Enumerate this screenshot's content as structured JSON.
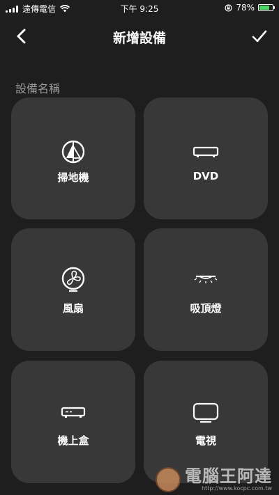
{
  "status_bar": {
    "carrier": "遠傳電信",
    "time": "下午 9:25",
    "battery": "78%",
    "battery_level": 0.78,
    "signal_icon": "signal-bars-icon",
    "wifi_icon": "wifi-icon",
    "rotation_lock_icon": "rotation-lock-icon",
    "battery_icon": "battery-charging-icon"
  },
  "nav": {
    "title": "新增設備",
    "back_icon": "chevron-left-icon",
    "confirm_icon": "checkmark-icon"
  },
  "section": {
    "label": "設備名稱"
  },
  "devices": [
    {
      "label": "掃地機",
      "icon": "robot-vacuum-icon"
    },
    {
      "label": "DVD",
      "icon": "dvd-player-icon"
    },
    {
      "label": "風扇",
      "icon": "fan-icon"
    },
    {
      "label": "吸頂燈",
      "icon": "ceiling-light-icon"
    },
    {
      "label": "機上盒",
      "icon": "set-top-box-icon"
    },
    {
      "label": "電視",
      "icon": "tv-icon"
    }
  ],
  "watermark": {
    "text": "電腦王阿達",
    "url": "http://www.kocpc.com.tw"
  },
  "colors": {
    "background": "#1e1e1e",
    "card": "#383838",
    "section_label": "#9a9a9a",
    "battery_fill": "#4cd964"
  }
}
